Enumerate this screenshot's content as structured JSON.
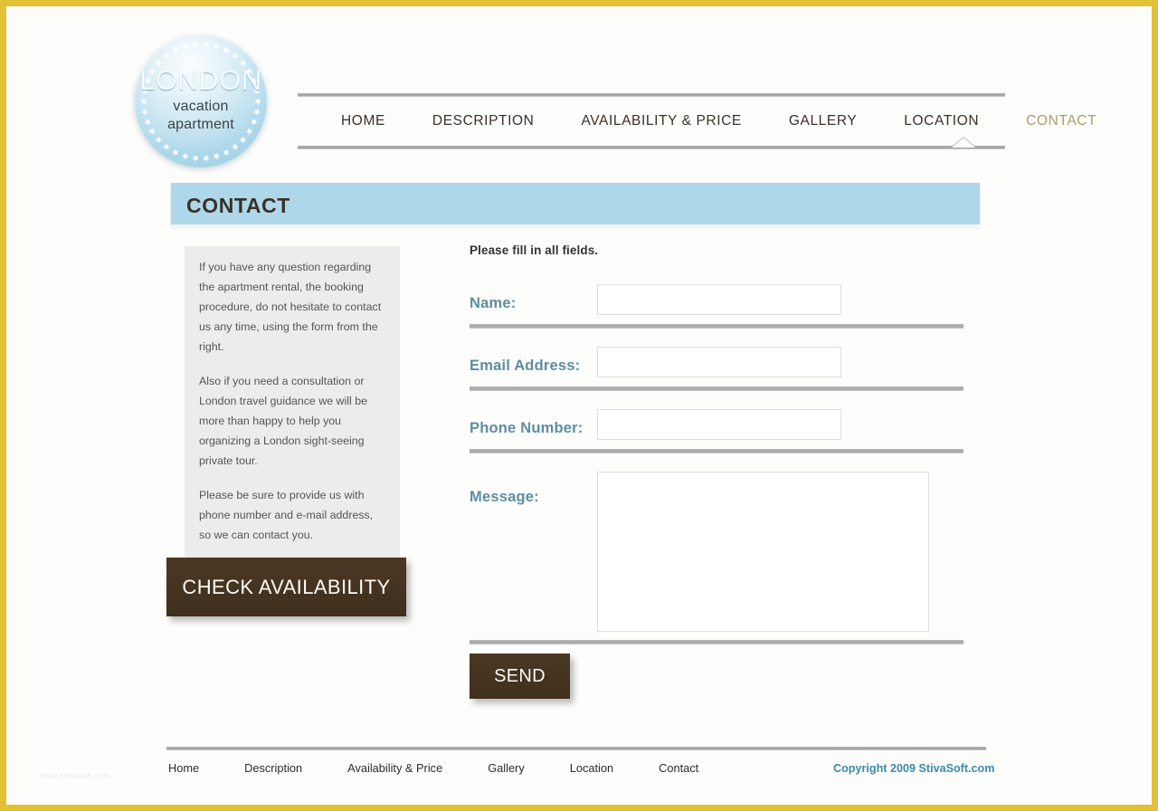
{
  "site": {
    "logo": {
      "title": "LONDON",
      "subtitle_line1": "vacation",
      "subtitle_line2": "apartment",
      "star_icon": "star-icon"
    },
    "frame_color": "#e2c134"
  },
  "nav": {
    "items": [
      {
        "label": "HOME",
        "active": false
      },
      {
        "label": "DESCRIPTION",
        "active": false
      },
      {
        "label": "AVAILABILITY & PRICE",
        "active": false
      },
      {
        "label": "GALLERY",
        "active": false
      },
      {
        "label": "LOCATION",
        "active": false
      },
      {
        "label": "CONTACT",
        "active": true
      }
    ],
    "active_color": "#b09a6d",
    "inactive_color": "#3a3027"
  },
  "page": {
    "title": "CONTACT",
    "title_bar_color": "#aed8ea"
  },
  "sidebar": {
    "paragraphs": [
      "If you have any question regarding the apartment rental, the booking procedure, do not hesitate to contact us any time, using the form from the right.",
      "Also if you need a consultation or London travel guidance we will be more than happy to help you organizing a London sight-seeing private tour.",
      "Please be sure to provide us with phone number and e-mail address, so we can contact you."
    ],
    "check_availability_label": "CHECK AVAILABILITY"
  },
  "form": {
    "hint": "Please fill in all fields.",
    "fields": [
      {
        "label": "Name:",
        "value": "",
        "placeholder": "",
        "type": "text",
        "name": "name-field"
      },
      {
        "label": "Email Address:",
        "value": "",
        "placeholder": "",
        "type": "text",
        "name": "email-field"
      },
      {
        "label": "Phone Number:",
        "value": "",
        "placeholder": "",
        "type": "text",
        "name": "phone-field"
      },
      {
        "label": "Message:",
        "value": "",
        "placeholder": "",
        "type": "textarea",
        "name": "message-field"
      }
    ],
    "submit_label": "SEND",
    "label_color": "#5d8da0",
    "button_color": "#43321f"
  },
  "footer": {
    "links": [
      "Home",
      "Description",
      "Availability & Price",
      "Gallery",
      "Location",
      "Contact"
    ],
    "copyright": "Copyright 2009 StivaSoft.com",
    "copyright_color": "#3b8aaa",
    "watermark": "www.stivasoft.com"
  }
}
